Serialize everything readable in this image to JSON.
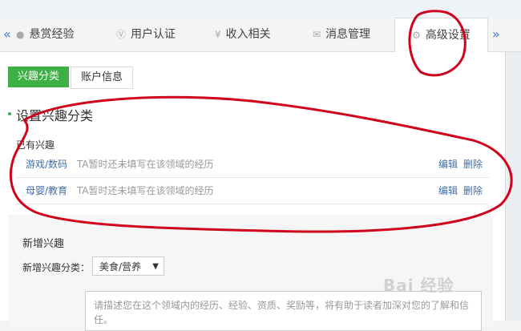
{
  "tabs": [
    {
      "label": "悬赏经验",
      "icon": "coin-icon"
    },
    {
      "label": "用户认证",
      "icon": "verify-icon"
    },
    {
      "label": "收入相关",
      "icon": "yen-icon"
    },
    {
      "label": "消息管理",
      "icon": "mail-icon"
    },
    {
      "label": "高级设置",
      "icon": "gear-icon",
      "active": true
    }
  ],
  "nav": {
    "prev": "«",
    "next": "»"
  },
  "subtabs": {
    "interest": "兴趣分类",
    "account": "账户信息"
  },
  "section": {
    "title": "设置兴趣分类",
    "existing_label": "已有兴趣"
  },
  "interests": [
    {
      "category": "游戏/数码",
      "description": "TA暂时还未填写在该领域的经历",
      "edit": "编辑",
      "delete": "删除"
    },
    {
      "category": "母婴/教育",
      "description": "TA暂时还未填写在该领域的经历",
      "edit": "编辑",
      "delete": "删除"
    }
  ],
  "add": {
    "title": "新增兴趣",
    "category_label": "新增兴趣分类：",
    "category_value": "美食/营养",
    "placeholder": "请描述您在这个领域内的经历、经验、资质、奖励等，将有助于读者加深对您的了解和信任。"
  },
  "watermark": "Bai 经验",
  "colors": {
    "accent": "#3cb043",
    "link": "#3f6ea6",
    "annotation": "#d0021b"
  }
}
